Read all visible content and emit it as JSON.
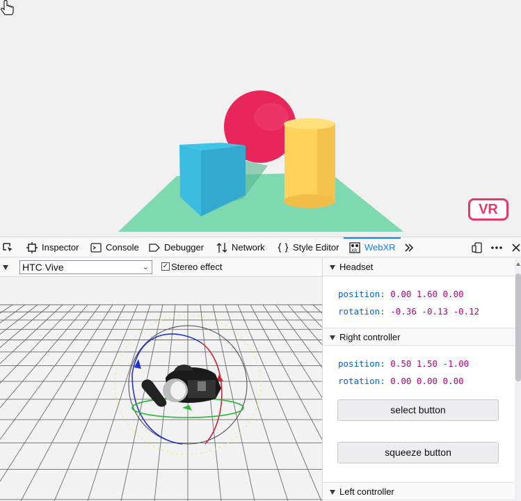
{
  "scene": {
    "vr_label": "VR"
  },
  "toolbar": {
    "tabs": [
      {
        "label": "Inspector"
      },
      {
        "label": "Console"
      },
      {
        "label": "Debugger"
      },
      {
        "label": "Network"
      },
      {
        "label": "Style Editor"
      },
      {
        "label": "WebXR"
      }
    ],
    "active_tab": "WebXR"
  },
  "viewport": {
    "device": "HTC Vive",
    "stereo_label": "Stereo effect",
    "stereo_checked": true
  },
  "panel": {
    "headset": {
      "title": "Headset",
      "position_label": "position:",
      "position_value": "0.00 1.60 0.00",
      "rotation_label": "rotation:",
      "rotation_value": "-0.36 -0.13 -0.12"
    },
    "right_controller": {
      "title": "Right controller",
      "position_label": "position:",
      "position_value": "0.50 1.50 -1.00",
      "rotation_label": "rotation:",
      "rotation_value": "0.00 0.00 0.00",
      "select_label": "select button",
      "squeeze_label": "squeeze button"
    },
    "left_controller": {
      "title": "Left controller"
    }
  },
  "colors": {
    "accent": "#0a84ff",
    "vr": "#e63866",
    "key": "#0060df",
    "value": "#b5007f"
  }
}
